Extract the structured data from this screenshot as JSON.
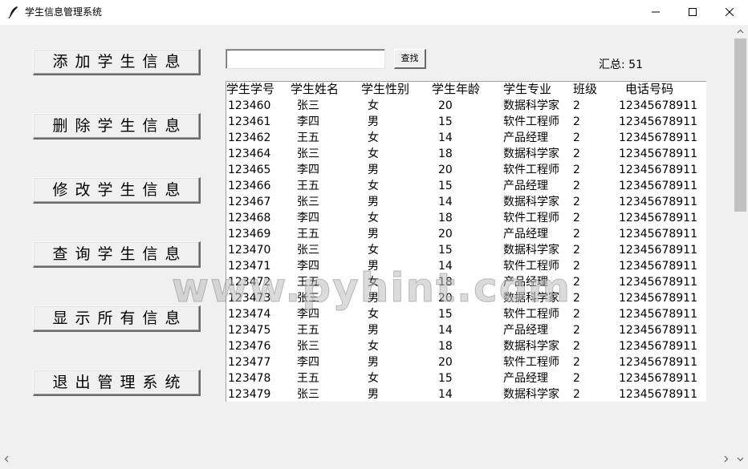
{
  "window": {
    "title": "学生信息管理系统",
    "icon": "feather-icon",
    "controls": {
      "minimize": "minimize-icon",
      "maximize": "maximize-icon",
      "close": "close-icon"
    }
  },
  "sidebar": {
    "add": "添加学生信息",
    "delete": "删除学生信息",
    "edit": "修改学生信息",
    "query": "查询学生信息",
    "show_all": "显示所有信息",
    "exit": "退出管理系统"
  },
  "search": {
    "value": "",
    "button": "查找"
  },
  "summary": {
    "label": "汇总:",
    "count": "51"
  },
  "table": {
    "headers": [
      "学生学号",
      "学生姓名",
      "学生性别",
      "学生年龄",
      "学生专业",
      "班级",
      "电话号码"
    ],
    "rows": [
      [
        "123460",
        "张三",
        "女",
        "20",
        "数据科学家",
        "2",
        "12345678911"
      ],
      [
        "123461",
        "李四",
        "男",
        "15",
        "软件工程师",
        "2",
        "12345678911"
      ],
      [
        "123462",
        "王五",
        "女",
        "14",
        "产品经理",
        "2",
        "12345678911"
      ],
      [
        "123464",
        "张三",
        "女",
        "18",
        "数据科学家",
        "2",
        "12345678911"
      ],
      [
        "123465",
        "李四",
        "男",
        "20",
        "软件工程师",
        "2",
        "12345678911"
      ],
      [
        "123466",
        "王五",
        "女",
        "15",
        "产品经理",
        "2",
        "12345678911"
      ],
      [
        "123467",
        "张三",
        "男",
        "14",
        "数据科学家",
        "2",
        "12345678911"
      ],
      [
        "123468",
        "李四",
        "女",
        "18",
        "软件工程师",
        "2",
        "12345678911"
      ],
      [
        "123469",
        "王五",
        "男",
        "20",
        "产品经理",
        "2",
        "12345678911"
      ],
      [
        "123470",
        "张三",
        "女",
        "15",
        "数据科学家",
        "2",
        "12345678911"
      ],
      [
        "123471",
        "李四",
        "男",
        "14",
        "软件工程师",
        "2",
        "12345678911"
      ],
      [
        "123472",
        "王五",
        "女",
        "18",
        "产品经理",
        "2",
        "12345678911"
      ],
      [
        "123473",
        "张三",
        "男",
        "20",
        "数据科学家",
        "2",
        "12345678911"
      ],
      [
        "123474",
        "李四",
        "女",
        "15",
        "软件工程师",
        "2",
        "12345678911"
      ],
      [
        "123475",
        "王五",
        "男",
        "14",
        "产品经理",
        "2",
        "12345678911"
      ],
      [
        "123476",
        "张三",
        "女",
        "18",
        "数据科学家",
        "2",
        "12345678911"
      ],
      [
        "123477",
        "李四",
        "男",
        "20",
        "软件工程师",
        "2",
        "12345678911"
      ],
      [
        "123478",
        "王五",
        "女",
        "15",
        "产品经理",
        "2",
        "12345678911"
      ],
      [
        "123479",
        "张三",
        "男",
        "14",
        "数据科学家",
        "2",
        "12345678911"
      ]
    ]
  },
  "watermark": "www.pyhint.com"
}
